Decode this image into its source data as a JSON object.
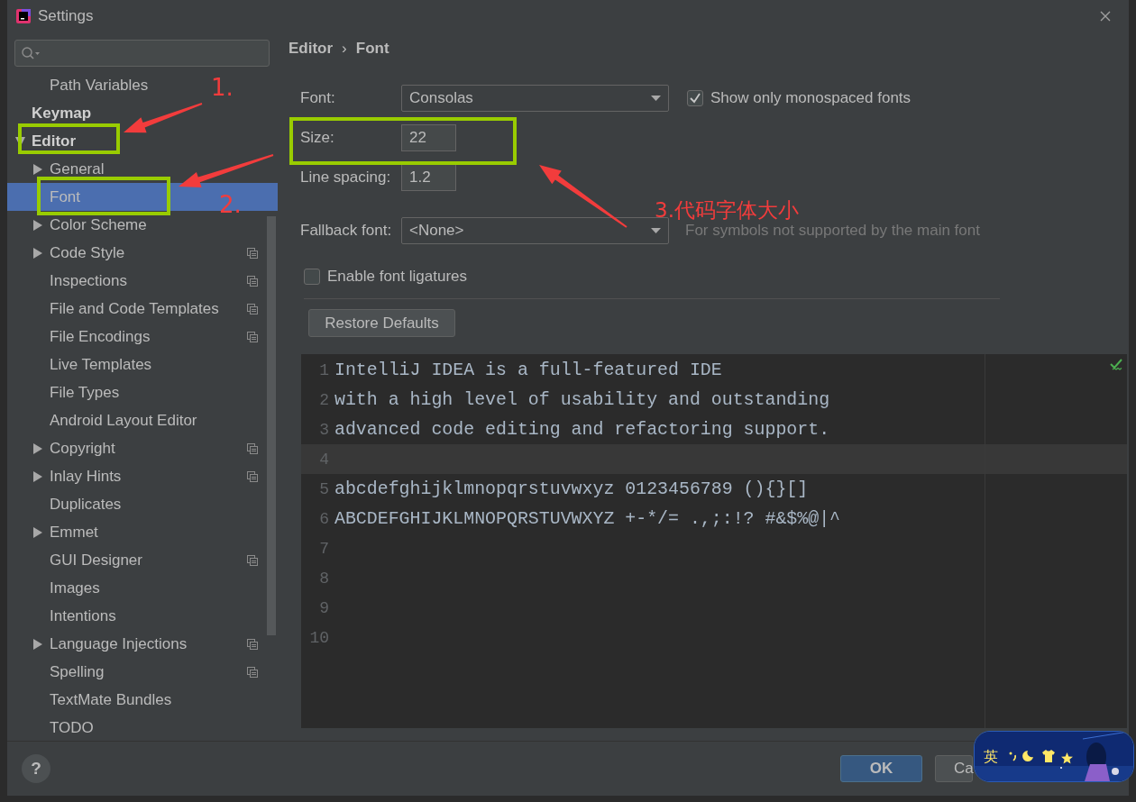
{
  "window": {
    "title": "Settings"
  },
  "sidebar": {
    "scrolled_parent_children": [
      {
        "label": "Path Variables",
        "selected": false
      }
    ],
    "items": [
      {
        "label": "Keymap",
        "selected": false
      },
      {
        "label": "Editor",
        "selected": false,
        "expanded": true,
        "children": [
          {
            "label": "General",
            "selected": false,
            "expanded": false,
            "project_scope": false
          },
          {
            "label": "Font",
            "selected": true,
            "project_scope": false
          },
          {
            "label": "Color Scheme",
            "selected": false,
            "expanded": false,
            "project_scope": false
          },
          {
            "label": "Code Style",
            "selected": false,
            "expanded": false,
            "project_scope": true
          },
          {
            "label": "Inspections",
            "selected": false,
            "project_scope": true
          },
          {
            "label": "File and Code Templates",
            "selected": false,
            "project_scope": true
          },
          {
            "label": "File Encodings",
            "selected": false,
            "project_scope": true
          },
          {
            "label": "Live Templates",
            "selected": false,
            "project_scope": false
          },
          {
            "label": "File Types",
            "selected": false,
            "project_scope": false
          },
          {
            "label": "Android Layout Editor",
            "selected": false,
            "project_scope": false
          },
          {
            "label": "Copyright",
            "selected": false,
            "expanded": false,
            "project_scope": true
          },
          {
            "label": "Inlay Hints",
            "selected": false,
            "expanded": false,
            "project_scope": true
          },
          {
            "label": "Duplicates",
            "selected": false,
            "project_scope": false
          },
          {
            "label": "Emmet",
            "selected": false,
            "expanded": false,
            "project_scope": false
          },
          {
            "label": "GUI Designer",
            "selected": false,
            "project_scope": true
          },
          {
            "label": "Images",
            "selected": false,
            "project_scope": false
          },
          {
            "label": "Intentions",
            "selected": false,
            "project_scope": false
          },
          {
            "label": "Language Injections",
            "selected": false,
            "expanded": false,
            "project_scope": true
          },
          {
            "label": "Spelling",
            "selected": false,
            "project_scope": true
          },
          {
            "label": "TextMate Bundles",
            "selected": false,
            "project_scope": false
          },
          {
            "label": "TODO",
            "selected": false,
            "project_scope": false
          }
        ]
      }
    ]
  },
  "breadcrumb": {
    "parent": "Editor",
    "separator": "›",
    "current": "Font"
  },
  "form": {
    "font": {
      "label": "Font:",
      "value": "Consolas"
    },
    "show_monospaced": {
      "label": "Show only monospaced fonts",
      "checked": true
    },
    "size": {
      "label": "Size:",
      "value": "22"
    },
    "line_spacing": {
      "label": "Line spacing:",
      "value": "1.2"
    },
    "fallback_font": {
      "label": "Fallback font:",
      "value": "<None>",
      "hint": "For symbols not supported by the main font"
    },
    "ligatures": {
      "label": "Enable font ligatures",
      "checked": false
    }
  },
  "restore_button": "Restore Defaults",
  "preview": {
    "lines": [
      {
        "number": "1",
        "text": "IntelliJ IDEA is a full-featured IDE",
        "caret_line": false
      },
      {
        "number": "2",
        "text": "with a high level of usability and outstanding",
        "caret_line": false
      },
      {
        "number": "3",
        "text": "advanced code editing and refactoring support.",
        "caret_line": false
      },
      {
        "number": "4",
        "caret_line": true
      },
      {
        "number": "5",
        "text": "abcdefghijklmnopqrstuvwxyz 0123456789 (){}[]",
        "caret_line": false
      },
      {
        "number": "6",
        "text": "ABCDEFGHIJKLMNOPQRSTUVWXYZ +-*/= .,;:!? #&$%@|^",
        "caret_line": false
      },
      {
        "number": "7",
        "caret_line": false
      },
      {
        "number": "8",
        "caret_line": false
      },
      {
        "number": "9",
        "caret_line": false
      },
      {
        "number": "10",
        "caret_line": false
      }
    ]
  },
  "footer": {
    "help": "?",
    "ok": "OK",
    "cancel": "Ca"
  },
  "annotations": {
    "labels": [
      "1.",
      "2.",
      "3.代码字体大小"
    ]
  },
  "ime_toolbar": {
    "mode": "英"
  }
}
